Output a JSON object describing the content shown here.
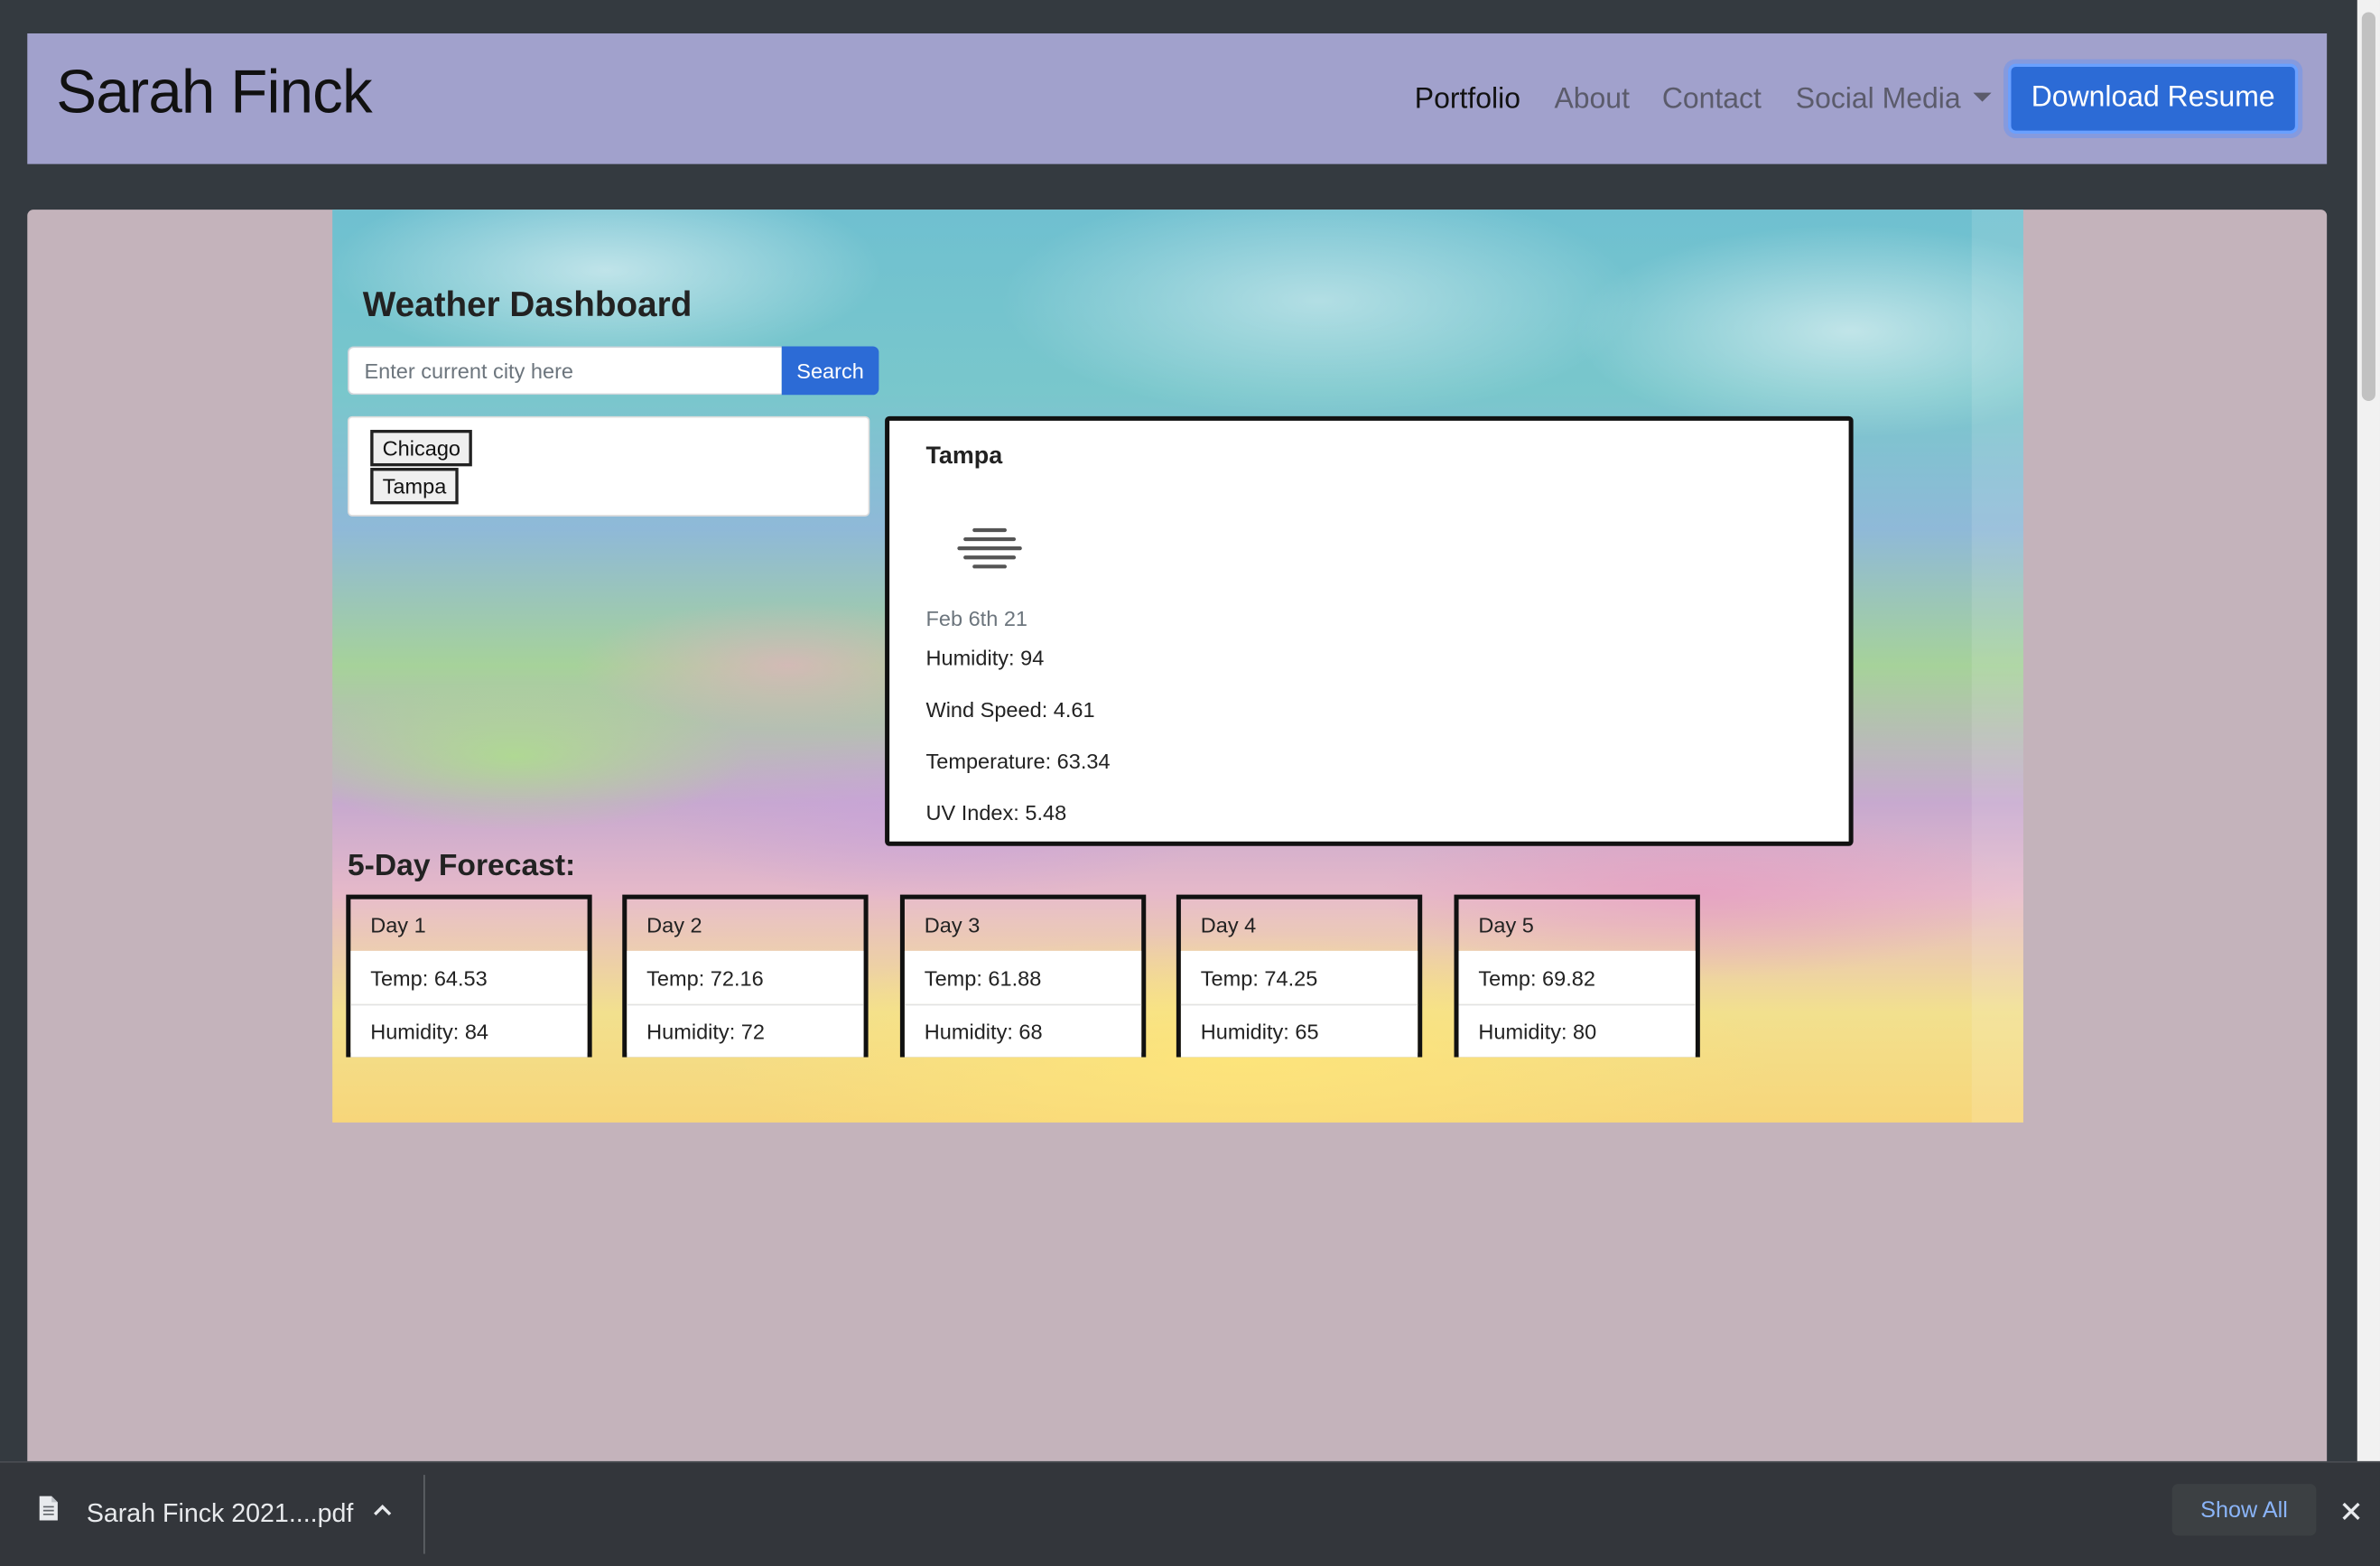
{
  "navbar": {
    "brand": "Sarah Finck",
    "links": [
      {
        "label": "Portfolio",
        "active": true
      },
      {
        "label": "About",
        "active": false
      },
      {
        "label": "Contact",
        "active": false
      },
      {
        "label": "Social Media",
        "active": false
      }
    ],
    "resume_button": "Download Resume",
    "background_color": "#a1a1cc",
    "accent_color": "#2c6bd6"
  },
  "weather": {
    "title": "Weather Dashboard",
    "search": {
      "placeholder": "Enter current city here",
      "value": "",
      "button": "Search"
    },
    "history": [
      "Chicago",
      "Tampa"
    ],
    "current": {
      "city": "Tampa",
      "icon": "mist-icon",
      "date": "Feb 6th 21",
      "humidity": "Humidity: 94",
      "wind": "Wind Speed: 4.61",
      "temperature": "Temperature: 63.34",
      "uv": "UV Index: 5.48"
    },
    "forecast_title": "5-Day Forecast:",
    "forecast": [
      {
        "day": "Day 1",
        "temp": "Temp: 64.53",
        "humidity": "Humidity: 84"
      },
      {
        "day": "Day 2",
        "temp": "Temp: 72.16",
        "humidity": "Humidity: 72"
      },
      {
        "day": "Day 3",
        "temp": "Temp: 61.88",
        "humidity": "Humidity: 68"
      },
      {
        "day": "Day 4",
        "temp": "Temp: 74.25",
        "humidity": "Humidity: 65"
      },
      {
        "day": "Day 5",
        "temp": "Temp: 69.82",
        "humidity": "Humidity: 80"
      }
    ]
  },
  "download_bar": {
    "file_name": "Sarah Finck 2021....pdf",
    "file_icon": "document-icon",
    "show_all": "Show All"
  }
}
